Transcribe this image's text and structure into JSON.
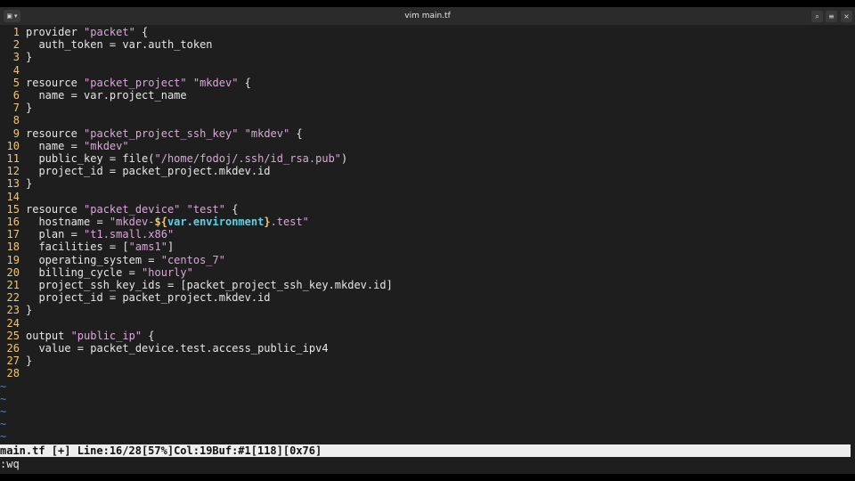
{
  "window": {
    "title": "vim main.tf",
    "buttons": {
      "menu_icon": "terminal-icon",
      "search": "⌕",
      "hamburger": "≡",
      "close": "×"
    }
  },
  "editor": {
    "lines": [
      {
        "n": "1",
        "parts": [
          {
            "t": "provider "
          },
          {
            "t": "\"packet\"",
            "c": "str"
          },
          {
            "t": " {"
          }
        ]
      },
      {
        "n": "2",
        "parts": [
          {
            "t": "  auth_token = var.auth_token"
          }
        ]
      },
      {
        "n": "3",
        "parts": [
          {
            "t": "}"
          }
        ]
      },
      {
        "n": "4",
        "parts": []
      },
      {
        "n": "5",
        "parts": [
          {
            "t": "resource "
          },
          {
            "t": "\"packet_project\"",
            "c": "str"
          },
          {
            "t": " "
          },
          {
            "t": "\"mkdev\"",
            "c": "str"
          },
          {
            "t": " {"
          }
        ]
      },
      {
        "n": "6",
        "parts": [
          {
            "t": "  name = var.project_name"
          }
        ]
      },
      {
        "n": "7",
        "parts": [
          {
            "t": "}"
          }
        ]
      },
      {
        "n": "8",
        "parts": []
      },
      {
        "n": "9",
        "parts": [
          {
            "t": "resource "
          },
          {
            "t": "\"packet_project_ssh_key\"",
            "c": "str"
          },
          {
            "t": " "
          },
          {
            "t": "\"mkdev\"",
            "c": "str"
          },
          {
            "t": " {"
          }
        ]
      },
      {
        "n": "10",
        "parts": [
          {
            "t": "  name = "
          },
          {
            "t": "\"mkdev\"",
            "c": "str"
          }
        ]
      },
      {
        "n": "11",
        "parts": [
          {
            "t": "  public_key = file("
          },
          {
            "t": "\"/home/fodoj/.ssh/id_rsa.pub\"",
            "c": "str"
          },
          {
            "t": ")"
          }
        ]
      },
      {
        "n": "12",
        "parts": [
          {
            "t": "  project_id = packet_project.mkdev.id"
          }
        ]
      },
      {
        "n": "13",
        "parts": [
          {
            "t": "}"
          }
        ]
      },
      {
        "n": "14",
        "parts": []
      },
      {
        "n": "15",
        "parts": [
          {
            "t": "resource "
          },
          {
            "t": "\"packet_device\"",
            "c": "str"
          },
          {
            "t": " "
          },
          {
            "t": "\"test\"",
            "c": "str"
          },
          {
            "t": " {"
          }
        ]
      },
      {
        "n": "16",
        "parts": [
          {
            "t": "  hostname = "
          },
          {
            "t": "\"mkdev-",
            "c": "str"
          },
          {
            "t": "${",
            "c": "brace"
          },
          {
            "t": "var.environment",
            "c": "interp"
          },
          {
            "t": "}",
            "c": "brace"
          },
          {
            "t": ".test\"",
            "c": "str"
          }
        ]
      },
      {
        "n": "17",
        "parts": [
          {
            "t": "  plan = "
          },
          {
            "t": "\"t1.small.x86\"",
            "c": "str"
          }
        ]
      },
      {
        "n": "18",
        "parts": [
          {
            "t": "  facilities = ["
          },
          {
            "t": "\"ams1\"",
            "c": "str"
          },
          {
            "t": "]"
          }
        ]
      },
      {
        "n": "19",
        "parts": [
          {
            "t": "  operating_system = "
          },
          {
            "t": "\"centos_7\"",
            "c": "str"
          }
        ]
      },
      {
        "n": "20",
        "parts": [
          {
            "t": "  billing_cycle = "
          },
          {
            "t": "\"hourly\"",
            "c": "str"
          }
        ]
      },
      {
        "n": "21",
        "parts": [
          {
            "t": "  project_ssh_key_ids = [packet_project_ssh_key.mkdev.id]"
          }
        ]
      },
      {
        "n": "22",
        "parts": [
          {
            "t": "  project_id = packet_project.mkdev.id"
          }
        ]
      },
      {
        "n": "23",
        "parts": [
          {
            "t": "}"
          }
        ]
      },
      {
        "n": "24",
        "parts": []
      },
      {
        "n": "25",
        "parts": [
          {
            "t": "output "
          },
          {
            "t": "\"public_ip\"",
            "c": "str"
          },
          {
            "t": " {"
          }
        ]
      },
      {
        "n": "26",
        "parts": [
          {
            "t": "  value = packet_device.test.access_public_ipv4"
          }
        ]
      },
      {
        "n": "27",
        "parts": [
          {
            "t": "}"
          }
        ]
      },
      {
        "n": "28",
        "parts": []
      }
    ],
    "empty_line_marker": "~",
    "empty_line_count": 5
  },
  "statusline": {
    "text": "main.tf [+] Line:16/28[57%]Col:19Buf:#1[118][0x76]"
  },
  "cmdline": {
    "text": ":wq"
  },
  "colors": {
    "background": "#1e1e1e",
    "line_number": "#f0c674",
    "string": "#d8a8d8",
    "interpolation": "#62cfe0",
    "tilde": "#4f7fd7",
    "statusline_bg": "#eeeeee"
  }
}
